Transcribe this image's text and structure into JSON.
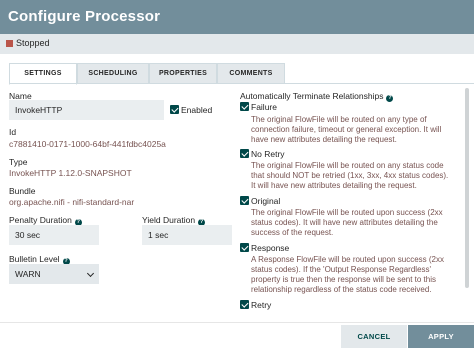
{
  "dialog": {
    "title": "Configure Processor"
  },
  "status": {
    "text": "Stopped"
  },
  "tabs": [
    {
      "label": "SETTINGS"
    },
    {
      "label": "SCHEDULING"
    },
    {
      "label": "PROPERTIES"
    },
    {
      "label": "COMMENTS"
    }
  ],
  "settings": {
    "name_label": "Name",
    "name_value": "InvokeHTTP",
    "enabled_label": "Enabled",
    "id_label": "Id",
    "id_value": "c7881410-0171-1000-64bf-441fdbc4025a",
    "type_label": "Type",
    "type_value": "InvokeHTTP 1.12.0-SNAPSHOT",
    "bundle_label": "Bundle",
    "bundle_value": "org.apache.nifi - nifi-standard-nar",
    "penalty_label": "Penalty Duration",
    "penalty_value": "30 sec",
    "yield_label": "Yield Duration",
    "yield_value": "1 sec",
    "bulletin_label": "Bulletin Level",
    "bulletin_value": "WARN"
  },
  "relationships": {
    "heading": "Automatically Terminate Relationships",
    "items": [
      {
        "name": "Failure",
        "checked": true,
        "desc": [
          "The original FlowFile will be routed on any type of",
          "connection failure, timeout or general exception. It will",
          "have new attributes detailing the request."
        ]
      },
      {
        "name": "No Retry",
        "checked": true,
        "desc": [
          "The original FlowFile will be routed on any status code",
          "that should NOT be retried (1xx, 3xx, 4xx status codes).",
          "It will have new attributes detailing the request."
        ]
      },
      {
        "name": "Original",
        "checked": true,
        "desc": [
          "The original FlowFile will be routed upon success (2xx",
          "status codes). It will have new attributes detailing the",
          "success of the request."
        ]
      },
      {
        "name": "Response",
        "checked": true,
        "desc": [
          "A Response FlowFile will be routed upon success (2xx",
          "status codes). If the 'Output Response Regardless'",
          "property is true then the response will be sent to this",
          "relationship regardless of the status code received."
        ]
      },
      {
        "name": "Retry",
        "checked": true,
        "desc": []
      }
    ]
  },
  "footer": {
    "cancel_label": "CANCEL",
    "apply_label": "APPLY"
  },
  "icons": {
    "info": "info-circle-icon",
    "check": "checkbox-checked-icon",
    "chevron": "chevron-down-icon",
    "stopped": "stopped-square-icon"
  },
  "colors": {
    "header": "#728e9b",
    "accent": "#004849",
    "stopped": "#ba554a",
    "value_text": "#775351"
  }
}
